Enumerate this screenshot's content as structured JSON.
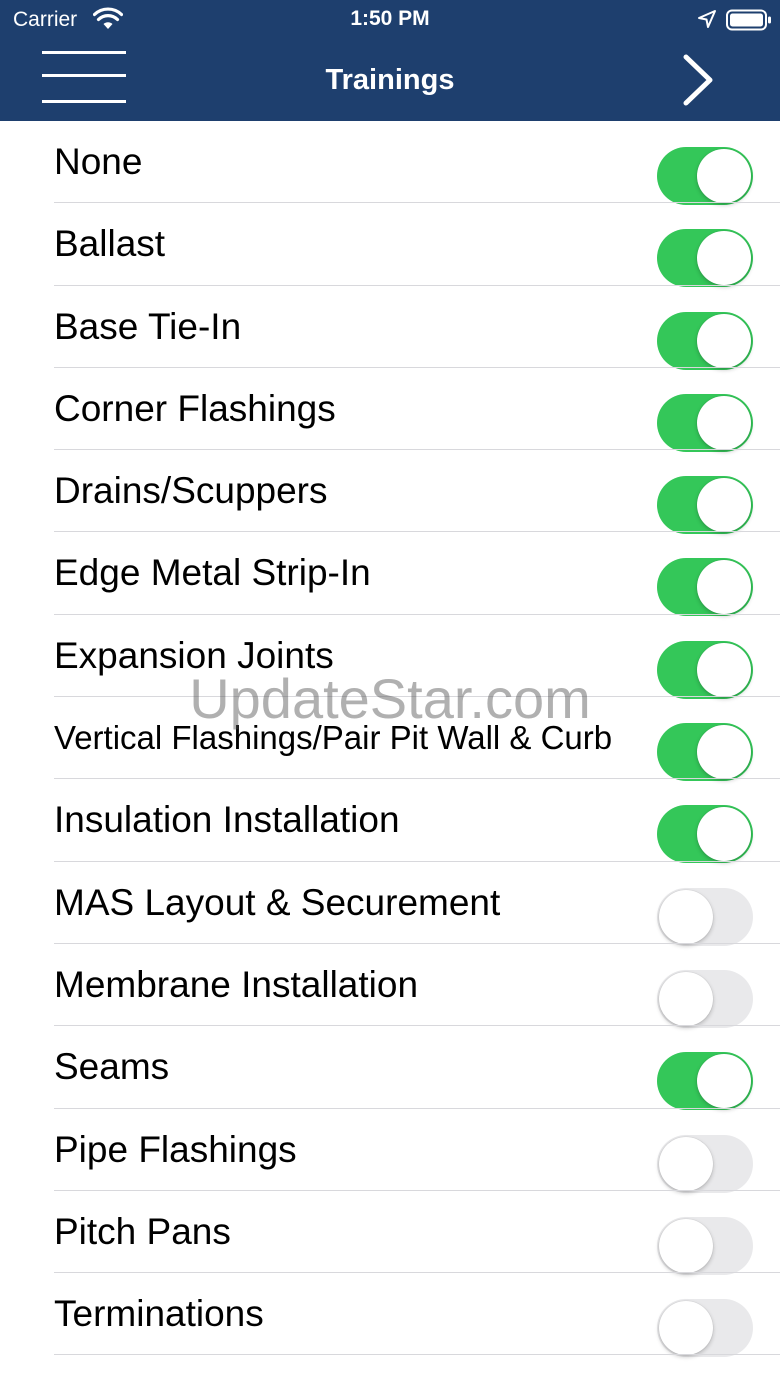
{
  "status_bar": {
    "carrier": "Carrier",
    "time": "1:50 PM",
    "wifi_icon": "wifi-icon",
    "location_icon": "location-arrow-icon",
    "battery_icon": "battery-icon"
  },
  "header": {
    "title": "Trainings",
    "menu_icon": "hamburger-menu-icon",
    "next_icon": "chevron-right-icon",
    "background_color": "#1e3f6e"
  },
  "colors": {
    "toggle_on": "#34c759",
    "toggle_off": "#e9e9eb"
  },
  "trainings": [
    {
      "label": "None",
      "enabled": true
    },
    {
      "label": "Ballast",
      "enabled": true
    },
    {
      "label": "Base Tie-In",
      "enabled": true
    },
    {
      "label": "Corner Flashings",
      "enabled": true
    },
    {
      "label": "Drains/Scuppers",
      "enabled": true
    },
    {
      "label": "Edge Metal Strip-In",
      "enabled": true
    },
    {
      "label": "Expansion Joints",
      "enabled": true
    },
    {
      "label": "Vertical Flashings/Pair Pit Wall & Curb",
      "enabled": true
    },
    {
      "label": "Insulation Installation",
      "enabled": true
    },
    {
      "label": "MAS Layout & Securement",
      "enabled": false
    },
    {
      "label": "Membrane Installation",
      "enabled": false
    },
    {
      "label": "Seams",
      "enabled": true
    },
    {
      "label": "Pipe Flashings",
      "enabled": false
    },
    {
      "label": "Pitch Pans",
      "enabled": false
    },
    {
      "label": "Terminations",
      "enabled": false
    }
  ],
  "watermark": "UpdateStar.com"
}
